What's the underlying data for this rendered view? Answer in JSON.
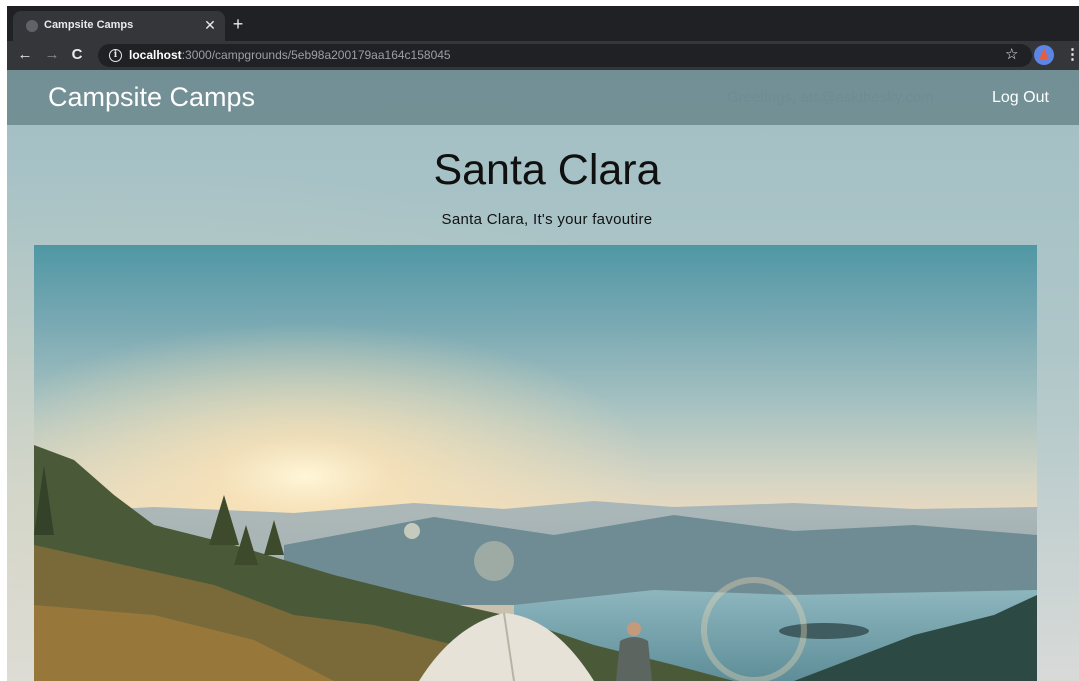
{
  "browser": {
    "tab_title": "Campsite Camps",
    "url_host": "localhost",
    "url_path": ":3000/campgrounds/5eb98a200179aa164c158045"
  },
  "navbar": {
    "brand": "Campsite Camps",
    "greeting": "Greetings, ats@askthesky.com",
    "logout_label": "Log Out"
  },
  "campground": {
    "name": "Santa Clara",
    "description": "Santa Clara, It's your favoutire"
  },
  "colors": {
    "navbar_bg": "#5f7d82",
    "chrome_bg": "#202124",
    "toolbar_bg": "#35363a"
  },
  "icons": {
    "tab_close": "close-icon",
    "new_tab": "plus-icon",
    "back": "arrow-left-icon",
    "forward": "arrow-right-icon",
    "reload": "reload-icon",
    "site_info": "info-icon",
    "bookmark": "star-icon",
    "menu": "kebab-menu-icon"
  }
}
